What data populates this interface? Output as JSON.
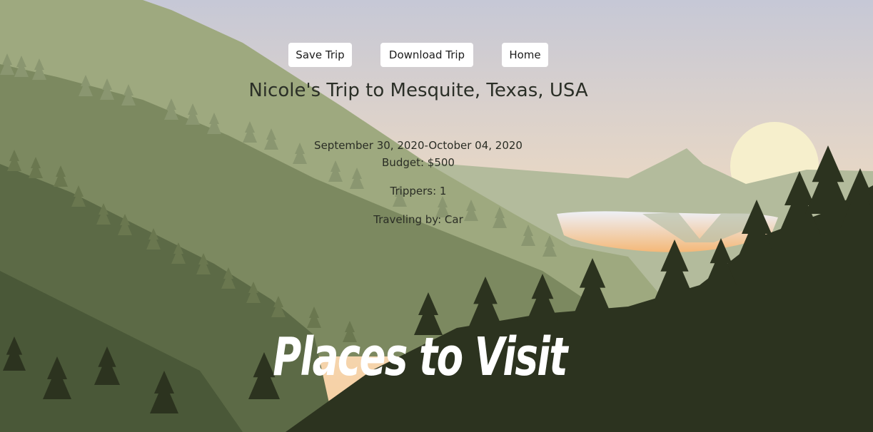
{
  "toolbar": {
    "save_label": "Save Trip",
    "download_label": "Download Trip",
    "home_label": "Home"
  },
  "trip": {
    "title": "Nicole's Trip to Mesquite, Texas, USA",
    "dates": "September 30, 2020-October 04, 2020",
    "budget": "Budget: $500",
    "trippers": "Trippers: 1",
    "traveling_by": "Traveling by: Car"
  },
  "places_heading": "Places to Visit",
  "colors": {
    "sky_top": "#c8c9d6",
    "sky_glow": "#f6d9ae",
    "sun": "#f6efcc",
    "hill_light": "#9ea97f",
    "hill_mid": "#7d8a61",
    "hill_dark": "#5b6a45",
    "forest": "#2c331f",
    "button_bg": "#ffffff"
  }
}
